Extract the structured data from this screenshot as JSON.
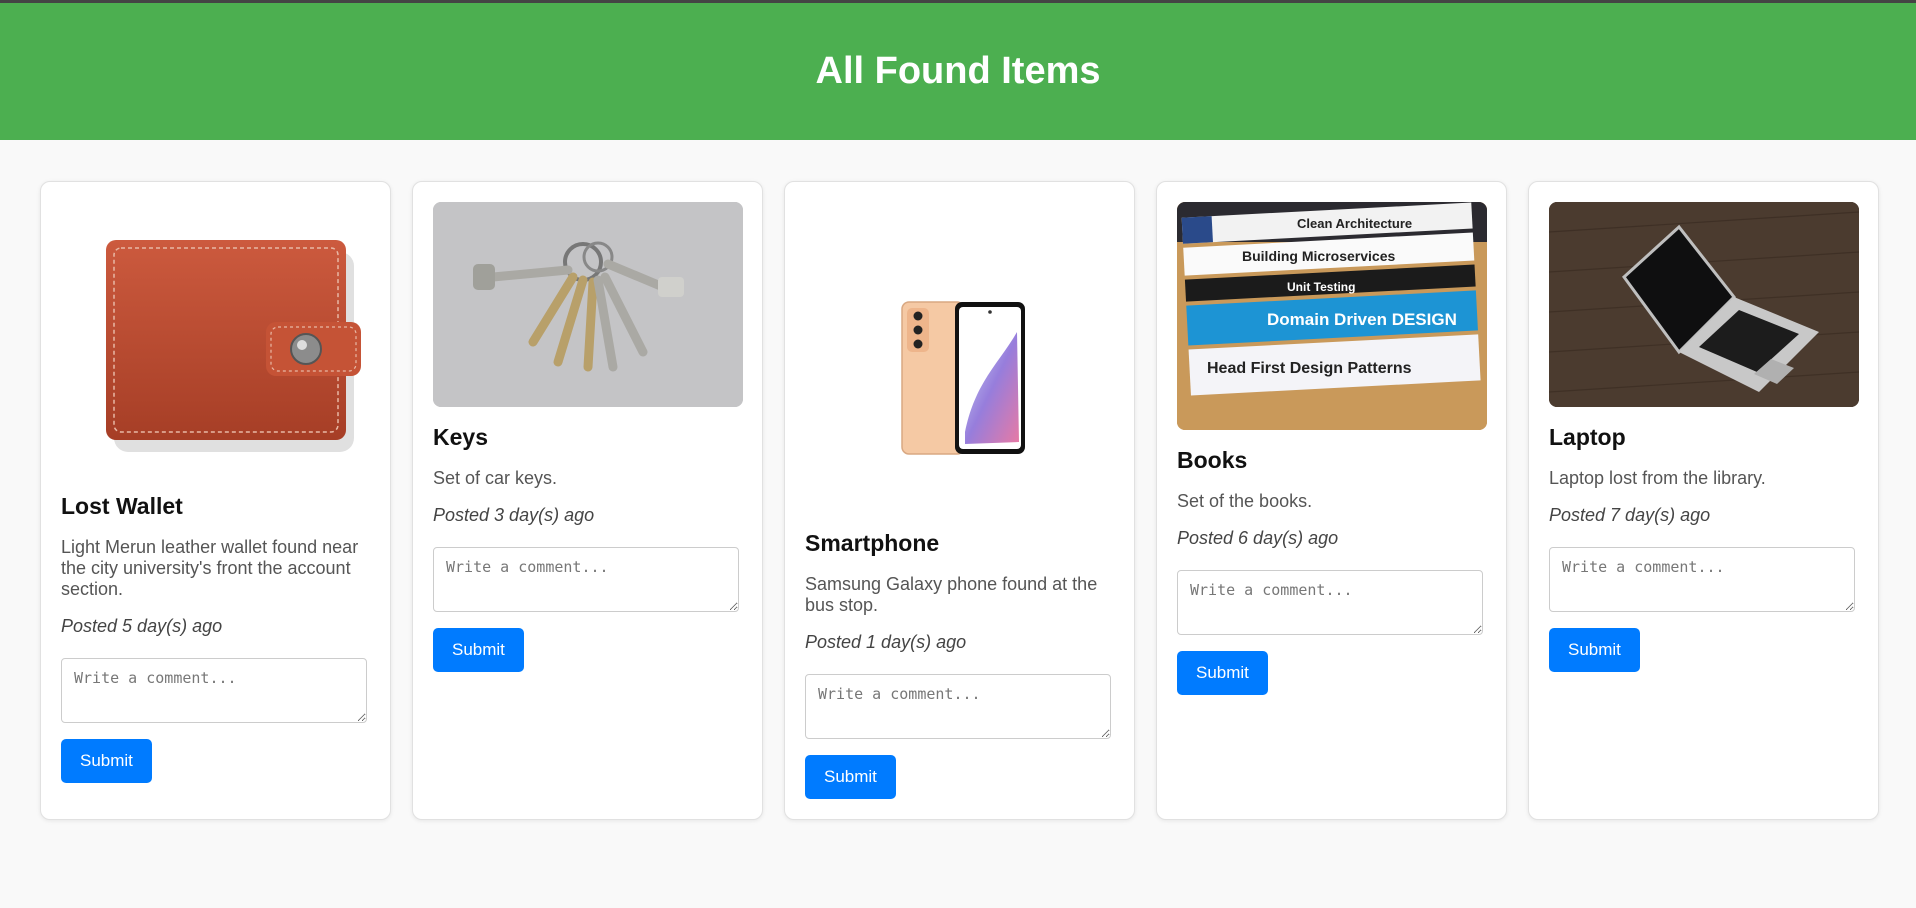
{
  "header": {
    "title": "All Found Items"
  },
  "comment_placeholder": "Write a comment...",
  "submit_label": "Submit",
  "colors": {
    "header": "#4caf50",
    "button": "#007bff"
  },
  "items": [
    {
      "title": "Lost Wallet",
      "description": "Light Merun leather wallet found near the city university's front the account section.",
      "posted": "Posted 5 day(s) ago",
      "image": "wallet-image"
    },
    {
      "title": "Keys",
      "description": "Set of car keys.",
      "posted": "Posted 3 day(s) ago",
      "image": "keys-image"
    },
    {
      "title": "Smartphone",
      "description": "Samsung Galaxy phone found at the bus stop.",
      "posted": "Posted 1 day(s) ago",
      "image": "smartphone-image"
    },
    {
      "title": "Books",
      "description": "Set of the books.",
      "posted": "Posted 6 day(s) ago",
      "image": "books-image",
      "book_titles": [
        "Clean Architecture",
        "Building Microservices",
        "Unit Testing",
        "Domain Driven DESIGN",
        "Head First Design Patterns"
      ]
    },
    {
      "title": "Laptop",
      "description": "Laptop lost from the library.",
      "posted": "Posted 7 day(s) ago",
      "image": "laptop-image"
    }
  ]
}
